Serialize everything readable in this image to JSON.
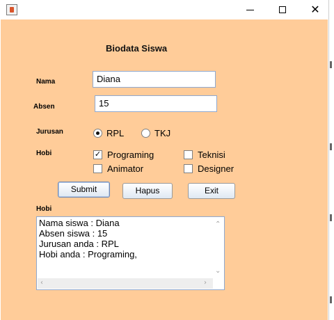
{
  "window": {
    "minimize_icon": "minimize-icon",
    "maximize_icon": "maximize-icon",
    "close_icon": "close-icon"
  },
  "form": {
    "title": "Biodata Siswa",
    "nama_label": "Nama",
    "nama_value": "Diana",
    "absen_label": "Absen",
    "absen_value": "15",
    "jurusan_label": "Jurusan",
    "jurusan_options": [
      {
        "label": "RPL",
        "selected": true
      },
      {
        "label": "TKJ",
        "selected": false
      }
    ],
    "hobi_label": "Hobi",
    "hobi_options": [
      {
        "label": "Programing",
        "checked": true
      },
      {
        "label": "Teknisi",
        "checked": false
      },
      {
        "label": "Animator",
        "checked": false
      },
      {
        "label": "Designer",
        "checked": false
      }
    ],
    "buttons": {
      "submit": "Submit",
      "hapus": "Hapus",
      "exit": "Exit"
    },
    "output_label": "Hobi",
    "output_text": "Nama siswa : Diana\nAbsen siswa : 15\nJurusan anda : RPL\nHobi anda : Programing,"
  },
  "colors": {
    "background": "#ffcc99",
    "field_border": "#8ea8d0"
  }
}
